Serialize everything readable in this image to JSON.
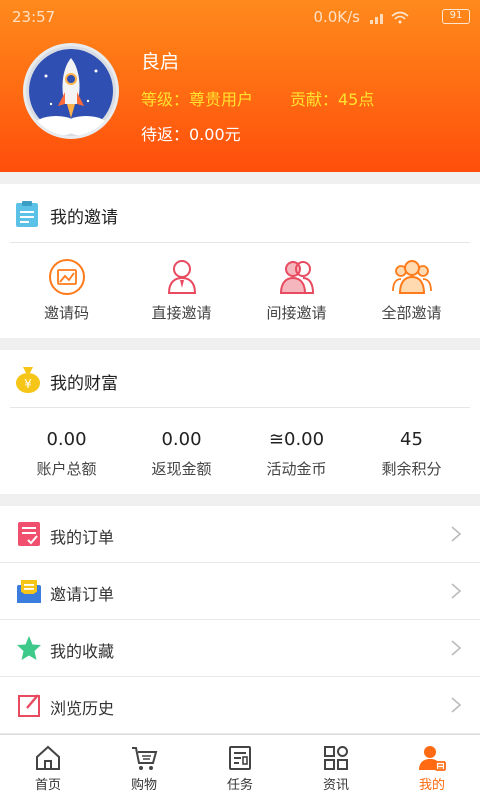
{
  "status_bar": {
    "time": "23:57",
    "network": "0.0K/s",
    "battery": "91"
  },
  "profile": {
    "name": "良启",
    "level": "等级：尊贵用户",
    "contribution": "贡献：45点",
    "pending": "待返：0.00元"
  },
  "invite": {
    "title": "我的邀请",
    "items": [
      {
        "label": "邀请码",
        "icon": "qrcode-icon"
      },
      {
        "label": "直接邀请",
        "icon": "person-icon"
      },
      {
        "label": "间接邀请",
        "icon": "two-people-icon"
      },
      {
        "label": "全部邀请",
        "icon": "group-icon"
      }
    ]
  },
  "wealth": {
    "title": "我的财富",
    "items": [
      {
        "value": "0.00",
        "label": "账户总额"
      },
      {
        "value": "0.00",
        "label": "返现金额"
      },
      {
        "value": "≅0.00",
        "label": "活动金币"
      },
      {
        "value": "45",
        "label": "剩余积分"
      }
    ]
  },
  "menu": [
    {
      "label": "我的订单",
      "icon": "order-icon"
    },
    {
      "label": "邀请订单",
      "icon": "envelope-icon"
    },
    {
      "label": "我的收藏",
      "icon": "star-icon"
    },
    {
      "label": "浏览历史",
      "icon": "edit-icon"
    }
  ],
  "tabs": [
    {
      "label": "首页",
      "icon": "home-icon",
      "active": false
    },
    {
      "label": "购物",
      "icon": "cart-icon",
      "active": false
    },
    {
      "label": "任务",
      "icon": "task-icon",
      "active": false
    },
    {
      "label": "资讯",
      "icon": "grid-icon",
      "active": false
    },
    {
      "label": "我的",
      "icon": "user-icon",
      "active": true
    }
  ],
  "colors": {
    "accent": "#ff6a12",
    "level_text": "#ffe12e",
    "header_top": "#ff8a1c",
    "header_bottom": "#ff4e0c"
  }
}
